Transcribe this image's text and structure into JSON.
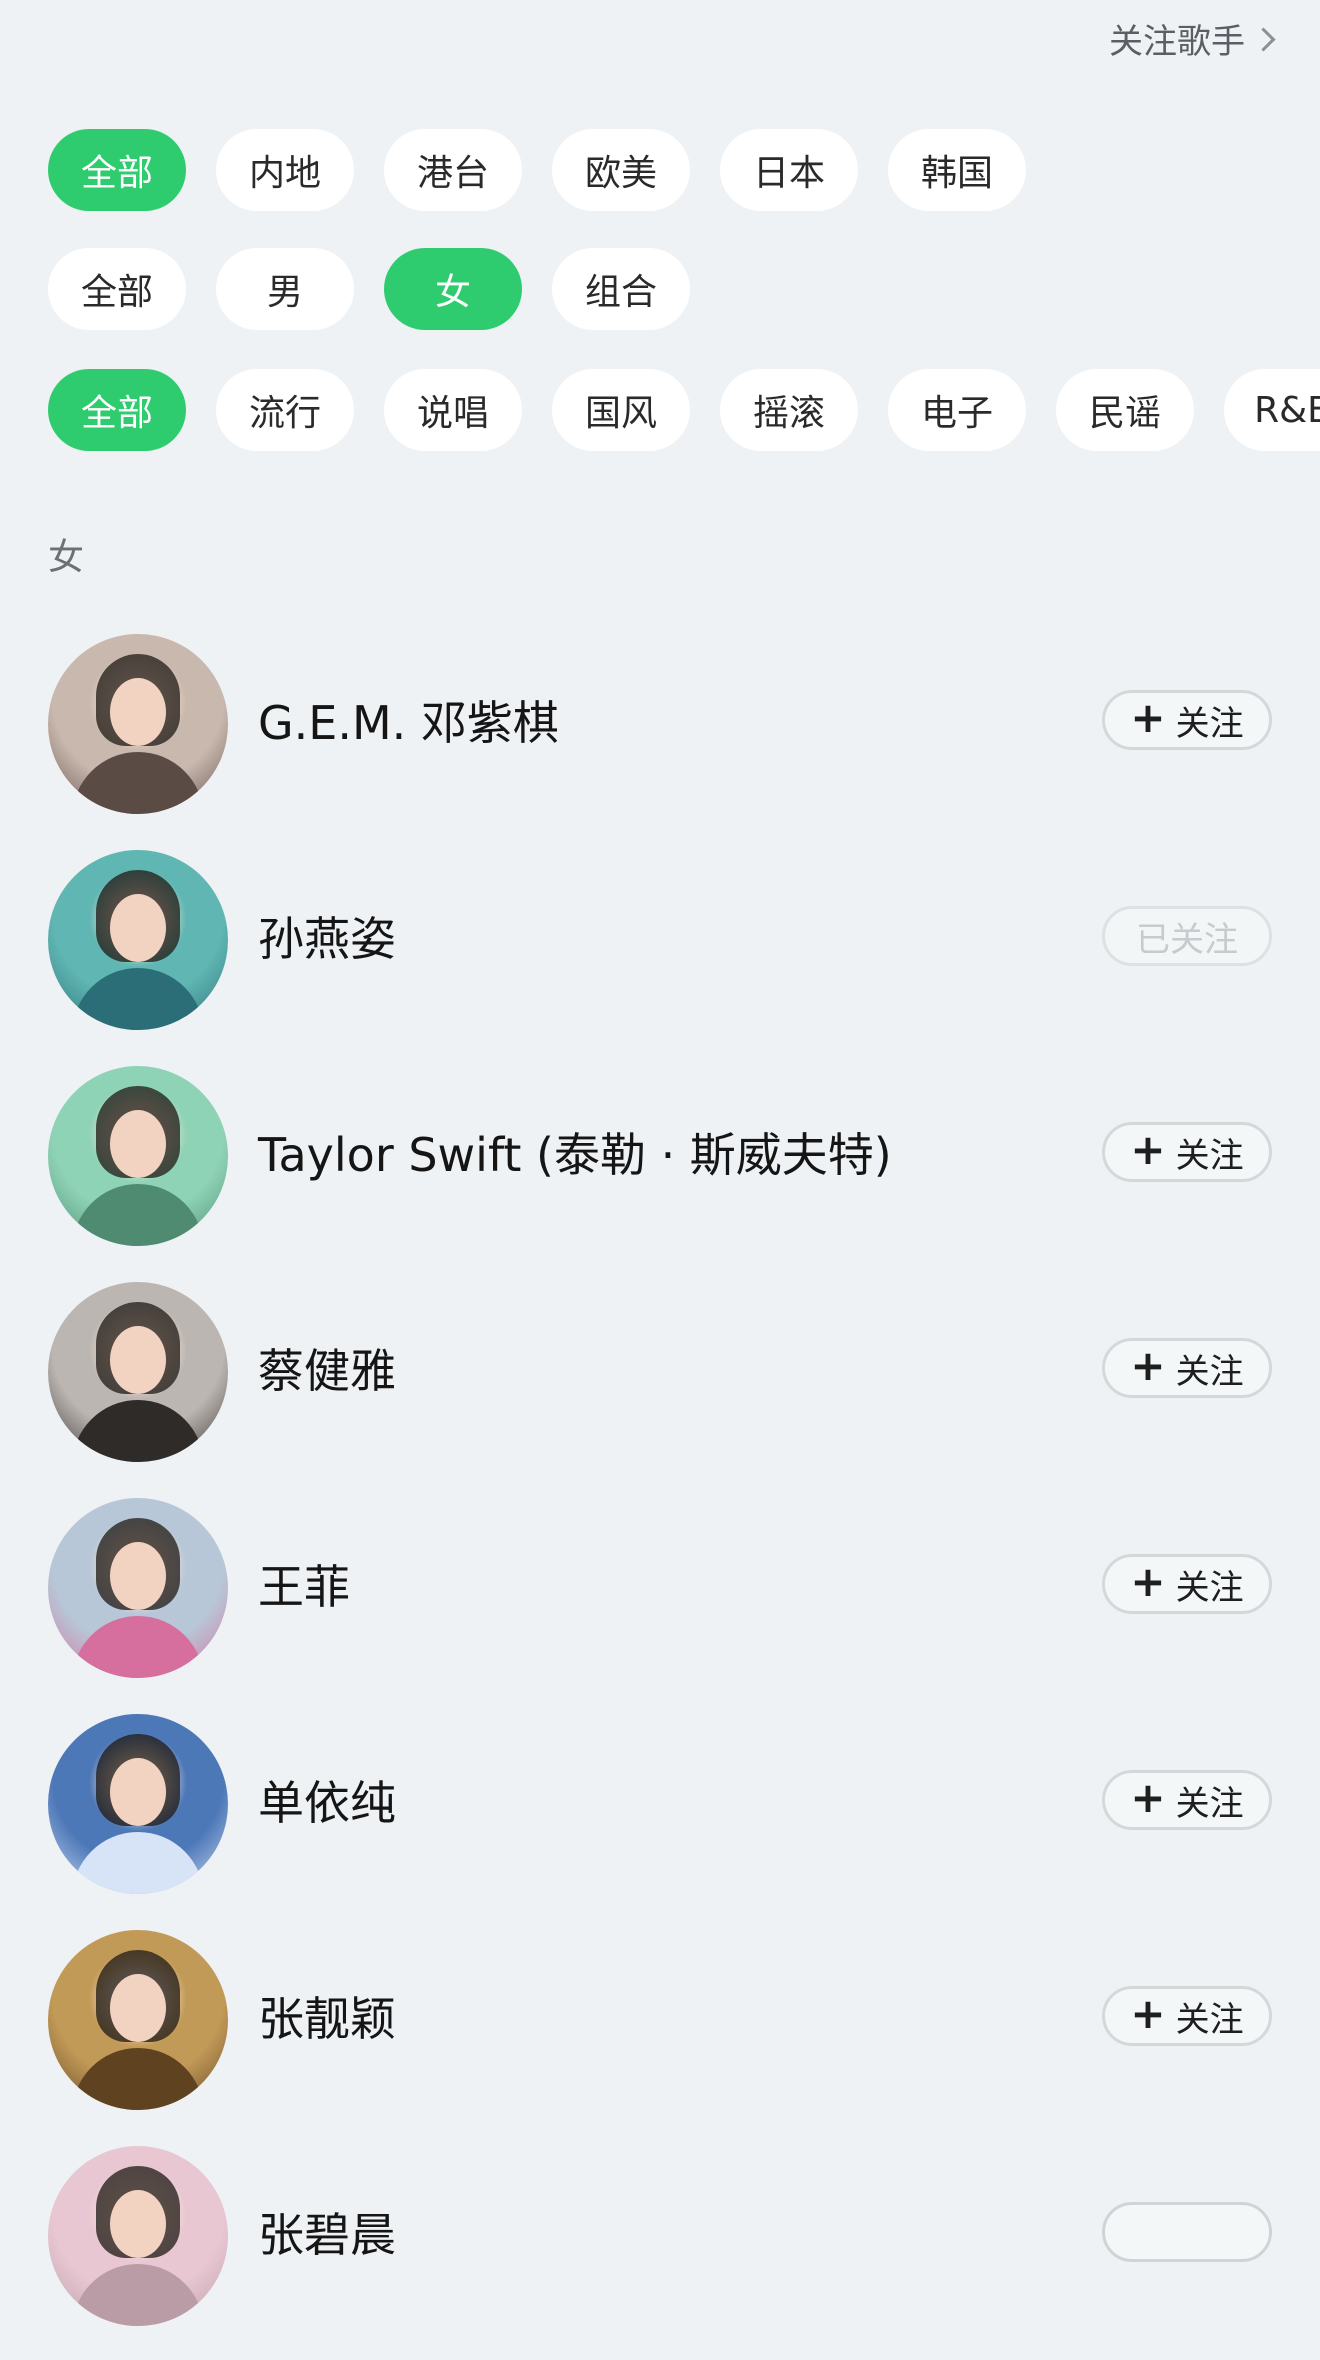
{
  "header": {
    "follow_singers_label": "关注歌手"
  },
  "filters": {
    "region": [
      {
        "label": "全部",
        "active": true
      },
      {
        "label": "内地",
        "active": false
      },
      {
        "label": "港台",
        "active": false
      },
      {
        "label": "欧美",
        "active": false
      },
      {
        "label": "日本",
        "active": false
      },
      {
        "label": "韩国",
        "active": false
      }
    ],
    "gender": [
      {
        "label": "全部",
        "active": false
      },
      {
        "label": "男",
        "active": false
      },
      {
        "label": "女",
        "active": true
      },
      {
        "label": "组合",
        "active": false
      }
    ],
    "genre": [
      {
        "label": "全部",
        "active": true
      },
      {
        "label": "流行",
        "active": false
      },
      {
        "label": "说唱",
        "active": false
      },
      {
        "label": "国风",
        "active": false
      },
      {
        "label": "摇滚",
        "active": false
      },
      {
        "label": "电子",
        "active": false
      },
      {
        "label": "民谣",
        "active": false
      },
      {
        "label": "R&B",
        "active": false
      }
    ]
  },
  "section": {
    "label": "女"
  },
  "artists": [
    {
      "name": "G.E.M. 邓紫棋",
      "button_label": "关注",
      "followed": false,
      "avatar_colors": {
        "bg": "#c9b8ae",
        "accent": "#5a4b44"
      }
    },
    {
      "name": "孙燕姿",
      "button_label": "已关注",
      "followed": true,
      "avatar_colors": {
        "bg": "#5fb6b2",
        "accent": "#2c6e77"
      }
    },
    {
      "name": "Taylor Swift (泰勒 · 斯威夫特)",
      "button_label": "关注",
      "followed": false,
      "avatar_colors": {
        "bg": "#8fd3b7",
        "accent": "#4e8b71"
      }
    },
    {
      "name": "蔡健雅",
      "button_label": "关注",
      "followed": false,
      "avatar_colors": {
        "bg": "#bcb6b2",
        "accent": "#2f2b29"
      }
    },
    {
      "name": "王菲",
      "button_label": "关注",
      "followed": false,
      "avatar_colors": {
        "bg": "#b7c7d7",
        "accent": "#d66f9d"
      }
    },
    {
      "name": "单依纯",
      "button_label": "关注",
      "followed": false,
      "avatar_colors": {
        "bg": "#4d78b8",
        "accent": "#d7e4f7"
      }
    },
    {
      "name": "张靓颖",
      "button_label": "关注",
      "followed": false,
      "avatar_colors": {
        "bg": "#c29a58",
        "accent": "#5f4321"
      }
    },
    {
      "name": "张碧晨",
      "button_label": "",
      "followed": false,
      "avatar_colors": {
        "bg": "#e8c7d3",
        "accent": "#b99ca5"
      }
    }
  ]
}
